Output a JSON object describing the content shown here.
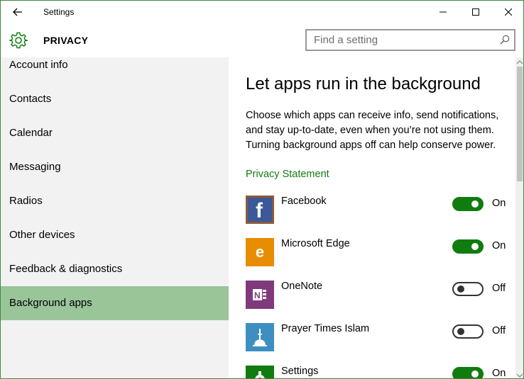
{
  "window": {
    "title": "Settings",
    "accent_color": "#107c10",
    "selected_bg": "#99c599"
  },
  "header": {
    "section": "PRIVACY",
    "search": {
      "placeholder": "Find a setting",
      "value": ""
    }
  },
  "sidebar": {
    "items": [
      {
        "label": "Account info"
      },
      {
        "label": "Contacts"
      },
      {
        "label": "Calendar"
      },
      {
        "label": "Messaging"
      },
      {
        "label": "Radios"
      },
      {
        "label": "Other devices"
      },
      {
        "label": "Feedback & diagnostics"
      },
      {
        "label": "Background apps",
        "selected": true
      }
    ]
  },
  "main": {
    "title": "Let apps run in the background",
    "description": "Choose which apps can receive info, send notifications, and stay up-to-date, even when you’re not using them. Turning background apps off can help conserve power.",
    "privacy_link": "Privacy Statement",
    "apps": [
      {
        "name": "Facebook",
        "state": "On",
        "on": true,
        "icon": "facebook-icon"
      },
      {
        "name": "Microsoft Edge",
        "state": "On",
        "on": true,
        "icon": "edge-icon"
      },
      {
        "name": "OneNote",
        "state": "Off",
        "on": false,
        "icon": "onenote-icon"
      },
      {
        "name": "Prayer Times Islam",
        "state": "Off",
        "on": false,
        "icon": "mosque-icon"
      },
      {
        "name": "Settings",
        "state": "On",
        "on": true,
        "icon": "settings-gear-icon"
      }
    ]
  }
}
